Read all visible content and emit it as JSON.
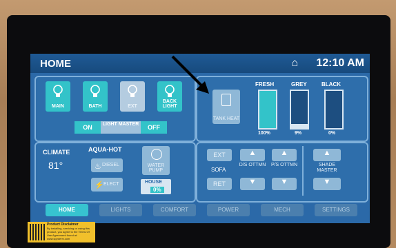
{
  "header": {
    "title": "HOME",
    "time": "12:10 AM"
  },
  "lights": {
    "tiles": [
      {
        "label": "MAIN",
        "state": "on"
      },
      {
        "label": "BATH",
        "state": "on"
      },
      {
        "label": "EXT",
        "state": "off"
      },
      {
        "label": "BACK LIGHT",
        "state": "on"
      }
    ],
    "master_on": "ON",
    "master_label": "LIGHT MASTER",
    "master_off": "OFF"
  },
  "tanks": {
    "heat_label": "TANK HEAT",
    "items": [
      {
        "label": "FRESH",
        "percent_text": "100%",
        "level": 1.0
      },
      {
        "label": "GREY",
        "percent_text": "9%",
        "level": 0.09
      },
      {
        "label": "BLACK",
        "percent_text": "0%",
        "level": 0.0
      }
    ]
  },
  "climate": {
    "label": "CLIMATE",
    "temperature": "81°",
    "aqua_hot_label": "AQUA-HOT",
    "diesel_label": "DIESEL",
    "elect_label": "ELECT",
    "water_pump_label": "WATER PUMP",
    "house_label": "HOUSE",
    "house_percent": "0%"
  },
  "furniture": {
    "ext_label": "EXT",
    "sofa_label": "SOFA",
    "ret_label": "RET",
    "ds_label": "D/S OTTMN",
    "ps_label": "P/S OTTMN",
    "shade_label": "SHADE MASTER"
  },
  "tabs": [
    "HOME",
    "LIGHTS",
    "COMFORT",
    "POWER",
    "MECH",
    "SETTINGS"
  ],
  "sticker": {
    "heading": "Product Disclaimer",
    "body": "By installing, servicing or using this product, you agree to the Terms Of Use Agreement found at: www.spyderrv.com"
  },
  "colors": {
    "accent": "#37c3d0",
    "screen_bg": "#2b69a8",
    "sticker": "#f1c02b"
  }
}
